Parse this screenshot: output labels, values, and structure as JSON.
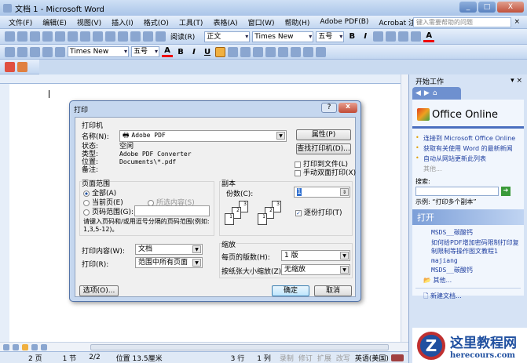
{
  "window": {
    "title": "文档 1 - Microsoft Word"
  },
  "menu": [
    "文件(F)",
    "编辑(E)",
    "视图(V)",
    "插入(I)",
    "格式(O)",
    "工具(T)",
    "表格(A)",
    "窗口(W)",
    "帮助(H)",
    "Adobe PDF(B)",
    "Acrobat 注释(C)"
  ],
  "help_placeholder": "键入需要帮助的问题",
  "toolbar1": {
    "read": "阅读(R)",
    "style": "正文",
    "font": "Times New Roman",
    "size": "五号",
    "bold": "B",
    "italic": "I",
    "fontcolor": "A"
  },
  "toolbar2": {
    "font": "Times New Roman",
    "size": "五号",
    "fontcolor": "A",
    "bold": "B",
    "italic": "I",
    "underline": "U"
  },
  "status": {
    "page": "2 页",
    "section": "1 节",
    "pages": "2/2",
    "position": "位置 13.5厘米",
    "line": "3 行",
    "col": "1 列",
    "rec": "录制",
    "trk": "修订",
    "ext": "扩展",
    "ovr": "改写",
    "lang": "英语(美国)"
  },
  "pane": {
    "title": "开始工作",
    "office": "Office Online",
    "links": [
      "连接到 Microsoft Office Online",
      "获取有关使用 Word 的最新新闻",
      "自动从网站更新此列表"
    ],
    "more": "其他...",
    "search_label": "搜索:",
    "example": "示例:  “打印多个副本”",
    "open_title": "打开",
    "files": [
      "MSDS__碳酸钙",
      "如何给PDF增加密码限制打印复制限制等操作图文教程1",
      "majiang",
      "MSDS__碳酸钙"
    ],
    "open_more": "其他...",
    "new_doc": "新建文档..."
  },
  "dialog": {
    "title": "打印",
    "printer_group": "打印机",
    "name_label": "名称(N):",
    "printer": "Adobe PDF",
    "status_label": "状态:",
    "status": "空闲",
    "type_label": "类型:",
    "type": "Adobe PDF Converter",
    "where_label": "位置:",
    "where": "Documents\\*.pdf",
    "comment_label": "备注:",
    "properties": "属性(P)",
    "find": "查找打印机(D)...",
    "to_file": "打印到文件(L)",
    "duplex": "手动双面打印(X)",
    "range_group": "页面范围",
    "all": "全部(A)",
    "current": "当前页(E)",
    "selection": "所选内容(S)",
    "pages": "页码范围(G):",
    "hint": "请键入页码和/或用逗号分隔的页码范围(例如: 1,3,5-12)。",
    "copies_group": "副本",
    "copies_label": "份数(C):",
    "copies": "1",
    "collate": "逐份打印(T)",
    "what_label": "打印内容(W):",
    "what": "文档",
    "print_label": "打印(R):",
    "print": "范围中所有页面",
    "zoom_group": "缩放",
    "pps_label": "每页的版数(H):",
    "pps": "1 版",
    "scale_label": "按纸张大小缩放(Z):",
    "scale": "无缩放",
    "options": "选项(O)...",
    "ok": "确定",
    "cancel": "取消"
  },
  "watermark": {
    "name": "这里教程网",
    "url": "herecours.com"
  }
}
